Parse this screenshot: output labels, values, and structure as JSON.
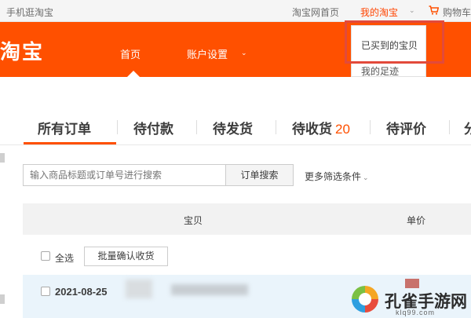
{
  "topbar": {
    "mobile_taobao": "手机逛淘宝",
    "taobao_home": "淘宝网首页",
    "my_taobao": "我的淘宝",
    "my_taobao_caret": "⌄",
    "cart_icon": "cart-icon",
    "cart": "购物车"
  },
  "header": {
    "logo": "淘宝",
    "nav_home": "首页",
    "nav_account": "账户设置",
    "nav_caret": "⌄"
  },
  "dropdown": {
    "bought_items": "已买到的宝贝",
    "my_footprint": "我的足迹"
  },
  "tabs": [
    {
      "label": "所有订单",
      "count": ""
    },
    {
      "label": "待付款",
      "count": ""
    },
    {
      "label": "待发货",
      "count": ""
    },
    {
      "label": "待收货",
      "count": "20"
    },
    {
      "label": "待评价",
      "count": ""
    },
    {
      "label": "分",
      "count": ""
    }
  ],
  "search": {
    "placeholder": "输入商品标题或订单号进行搜索",
    "button": "订单搜索",
    "more_filters": "更多筛选条件",
    "more_caret": "⌄"
  },
  "table": {
    "columns": [
      "宝贝",
      "单价"
    ],
    "select_all": "全选",
    "batch_confirm": "批量确认收货"
  },
  "order": {
    "date": "2021-08-25"
  },
  "watermark": {
    "name": "孔雀手游网",
    "url": "klq99.com"
  },
  "colors": {
    "brand_orange": "#ff5000",
    "highlight_red": "#e24a3b",
    "order_row_bg": "#eaf4fb"
  }
}
